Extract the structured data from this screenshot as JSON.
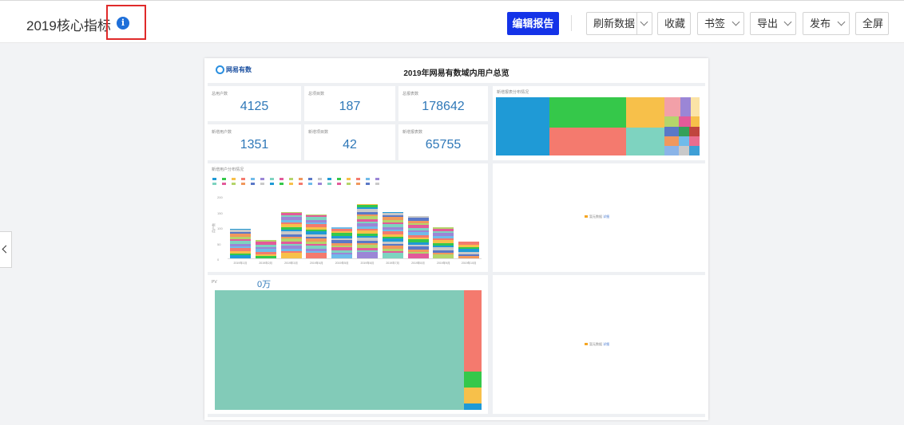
{
  "header": {
    "title": "2019核心指标",
    "buttons": {
      "edit": "编辑报告",
      "refresh": "刷新数据",
      "favorite": "收藏",
      "bookmark": "书签",
      "export": "导出",
      "publish": "发布",
      "fullscreen": "全屏"
    }
  },
  "report": {
    "logo_text": "网易有数",
    "title": "2019年网易有数域内用户总览",
    "kpis": [
      {
        "label": "总用户数",
        "value": "4125"
      },
      {
        "label": "总项目数",
        "value": "187"
      },
      {
        "label": "总报表数",
        "value": "178642"
      },
      {
        "label": "新增用户数",
        "value": "1351"
      },
      {
        "label": "新增项目数",
        "value": "42"
      },
      {
        "label": "新增报表数",
        "value": "65755"
      }
    ],
    "treemap_title": "新增报表分布情况",
    "bar_chart_title": "新增用户分布情况",
    "pv_title": "PV",
    "pv_value": "0万",
    "nodata_text": "暂无数据",
    "nodata_link": "详细"
  },
  "chart_data": {
    "type": "bar",
    "title": "新增用户分布情况",
    "categories": [
      "2019年1月",
      "2019年2月",
      "2019年3月",
      "2019年4月",
      "2019年5月",
      "2019年6月",
      "2019年7月",
      "2019年8月",
      "2019年9月",
      "2019年10月"
    ],
    "values": [
      95,
      60,
      150,
      140,
      100,
      175,
      150,
      135,
      100,
      55
    ],
    "ylim": [
      0,
      200
    ],
    "ylabel": "用户数",
    "y_ticks": [
      "0",
      "50",
      "100",
      "150",
      "200"
    ],
    "legend": "top"
  },
  "colors": {
    "primary": "#1433e8",
    "kpi": "#2f78b8",
    "highlight": "#e02a2a",
    "series": [
      "#1f9ad6",
      "#35c84a",
      "#f7c04a",
      "#f47a6e",
      "#6fbbea",
      "#9b86d6",
      "#7ed3c0",
      "#e35a9a",
      "#b4d56b",
      "#f0985d",
      "#5a78c7",
      "#c9c9c9"
    ]
  }
}
